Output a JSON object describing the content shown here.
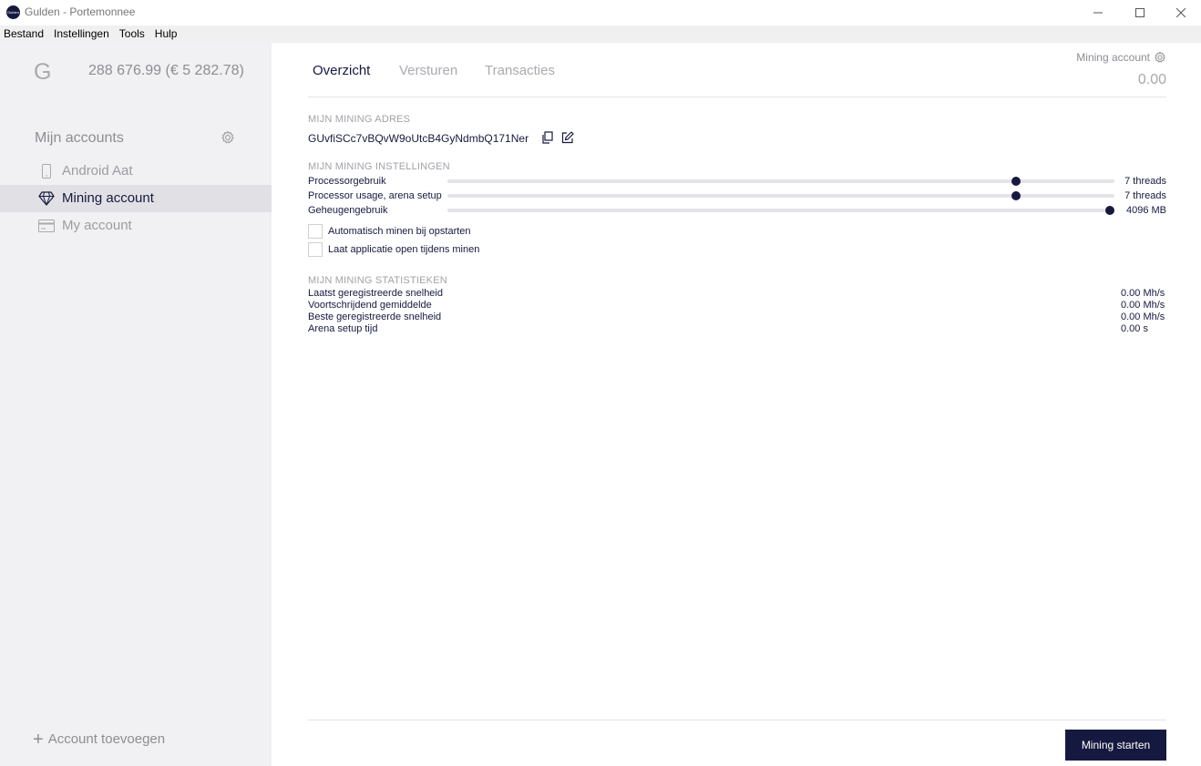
{
  "window": {
    "logo_text": "Gulden",
    "title": "Gulden - Portemonnee"
  },
  "menu": [
    "Bestand",
    "Instellingen",
    "Tools",
    "Hulp"
  ],
  "sidebar": {
    "logo_letter": "G",
    "balance": "288 676.99 (€ 5 282.78)",
    "accounts_title": "Mijn accounts",
    "accounts": [
      {
        "label": "Android Aat",
        "icon": "phone-icon",
        "active": false
      },
      {
        "label": "Mining account",
        "icon": "diamond-icon",
        "active": true
      },
      {
        "label": "My account",
        "icon": "card-icon",
        "active": false
      }
    ],
    "add_account_label": "Account toevoegen"
  },
  "tabs": [
    {
      "label": "Overzicht",
      "active": true
    },
    {
      "label": "Versturen",
      "active": false
    },
    {
      "label": "Transacties",
      "active": false
    }
  ],
  "header": {
    "account_name": "Mining account",
    "account_balance": "0.00"
  },
  "mining_address": {
    "title": "MIJN MINING ADRES",
    "address": "GUvfiSCc7vBQvW9oUtcB4GyNdmbQ171Ner"
  },
  "mining_settings": {
    "title": "MIJN MINING INSTELLINGEN",
    "sliders": [
      {
        "label": "Processorgebruik",
        "value_text": "7 threads",
        "fraction": 0.852
      },
      {
        "label": "Processor usage, arena setup",
        "value_text": "7 threads",
        "fraction": 0.852
      },
      {
        "label": "Geheugengebruik",
        "value_text": "4096 MB",
        "fraction": 0.993
      }
    ],
    "checkboxes": [
      {
        "label": "Automatisch minen bij opstarten",
        "checked": false
      },
      {
        "label": "Laat applicatie open tijdens minen",
        "checked": false
      }
    ]
  },
  "mining_stats": {
    "title": "MIJN MINING STATISTIEKEN",
    "rows": [
      {
        "label": "Laatst geregistreerde snelheid",
        "value": "0.00 Mh/s"
      },
      {
        "label": "Voortschrijdend gemiddelde",
        "value": "0.00 Mh/s"
      },
      {
        "label": "Beste geregistreerde snelheid",
        "value": "0.00 Mh/s"
      },
      {
        "label": "Arena setup tijd",
        "value": "0.00 s"
      }
    ]
  },
  "actions": {
    "start_label": "Mining starten"
  },
  "colors": {
    "accent": "#16193f",
    "sidebar_bg": "#f1f1f3",
    "sidebar_active_bg": "#e1e1e5",
    "muted_text": "#8d8d93"
  }
}
